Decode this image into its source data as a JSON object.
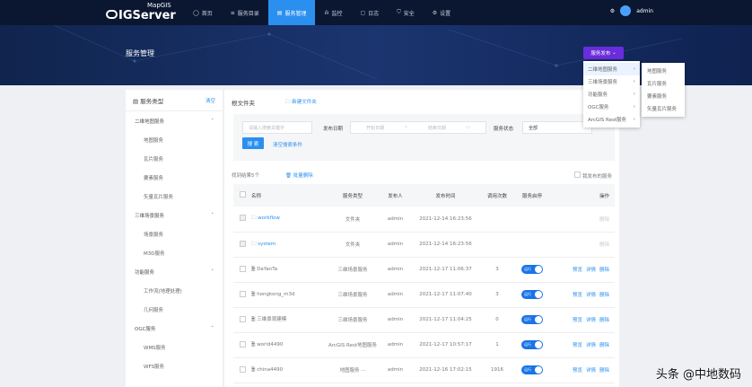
{
  "app": {
    "logo_small": "MapGIS",
    "logo_main": "IGServer"
  },
  "nav": {
    "items": [
      {
        "icon": "home-icon",
        "label": "首页"
      },
      {
        "icon": "list-icon",
        "label": "服务目录"
      },
      {
        "icon": "doc-icon",
        "label": "服务管理",
        "active": true
      },
      {
        "icon": "chart-icon",
        "label": "监控"
      },
      {
        "icon": "log-icon",
        "label": "日志"
      },
      {
        "icon": "shield-icon",
        "label": "安全"
      },
      {
        "icon": "gear-icon",
        "label": "设置"
      }
    ],
    "user": "admin"
  },
  "page": {
    "title": "服务管理",
    "publish_button": "服务发布"
  },
  "publish_menu": {
    "items": [
      "二维地图服务",
      "三维场景服务",
      "功能服务",
      "OGC服务",
      "ArcGIS Rest服务"
    ],
    "submenu": [
      "地图服务",
      "瓦片服务",
      "要素服务",
      "矢量瓦片服务"
    ]
  },
  "sidebar": {
    "title": "服务类型",
    "clear": "清空",
    "groups": [
      {
        "label": "二维地图服务",
        "items": [
          "地图服务",
          "瓦片服务",
          "要素服务",
          "矢量瓦片服务"
        ]
      },
      {
        "label": "三维场景服务",
        "items": [
          "场景服务",
          "M3D服务"
        ]
      },
      {
        "label": "功能服务",
        "items": [
          "工作流(地理处理)",
          "几何服务"
        ]
      },
      {
        "label": "OGC服务",
        "items": [
          "WMS服务",
          "WFS服务"
        ]
      }
    ]
  },
  "main": {
    "breadcrumb": "根文件夹",
    "new_folder": "新建文件夹",
    "filter": {
      "keyword_placeholder": "请输入搜索关键字",
      "date_label": "发布日期",
      "start_placeholder": "开始日期",
      "sep": "~",
      "end_placeholder": "结束日期",
      "status_label": "服务状态",
      "status_value": "全部",
      "search": "搜 索",
      "clear": "清空搜索条件"
    },
    "result_count": "找到结果5个",
    "batch_delete": "批量删除",
    "my_published": "我发布的服务",
    "columns": [
      "名称",
      "服务类型",
      "发布人",
      "发布时间",
      "调用次数",
      "服务启停",
      "操作"
    ],
    "rows": [
      {
        "name": "workflow",
        "type": "文件夹",
        "publisher": "admin",
        "time": "2021-12-14 16:23:56",
        "count": "",
        "folder": true,
        "ops": [
          "删除"
        ]
      },
      {
        "name": "system",
        "type": "文件夹",
        "publisher": "admin",
        "time": "2021-12-14 16:23:56",
        "count": "",
        "folder": true,
        "ops": [
          "删除"
        ]
      },
      {
        "name": "DaYanTa",
        "type": "三维场景服务",
        "publisher": "admin",
        "time": "2021-12-17 11:06:37",
        "count": "3",
        "switch": "运行",
        "ops": [
          "预览",
          "详情",
          "删除"
        ]
      },
      {
        "name": "hongkong_m3d",
        "type": "三维场景服务",
        "publisher": "admin",
        "time": "2021-12-17 11:07:40",
        "count": "3",
        "switch": "运行",
        "ops": [
          "预览",
          "详情",
          "删除"
        ]
      },
      {
        "name": "三维景观建模",
        "type": "三维场景服务",
        "publisher": "admin",
        "time": "2021-12-17 11:04:25",
        "count": "0",
        "switch": "运行",
        "ops": [
          "预览",
          "详情",
          "删除"
        ]
      },
      {
        "name": "world4490",
        "type": "ArcGIS Rest地图服务",
        "publisher": "admin",
        "time": "2021-12-17 10:57:17",
        "count": "1",
        "switch": "运行",
        "ops": [
          "预览",
          "详情",
          "删除"
        ]
      },
      {
        "name": "china4490",
        "type": "地图服务 ···",
        "publisher": "admin",
        "time": "2021-12-16 17:02:15",
        "count": "1916",
        "switch": "运行",
        "ops": [
          "预览",
          "详情",
          "删除"
        ]
      }
    ]
  },
  "watermark": "头条 @中地数码"
}
